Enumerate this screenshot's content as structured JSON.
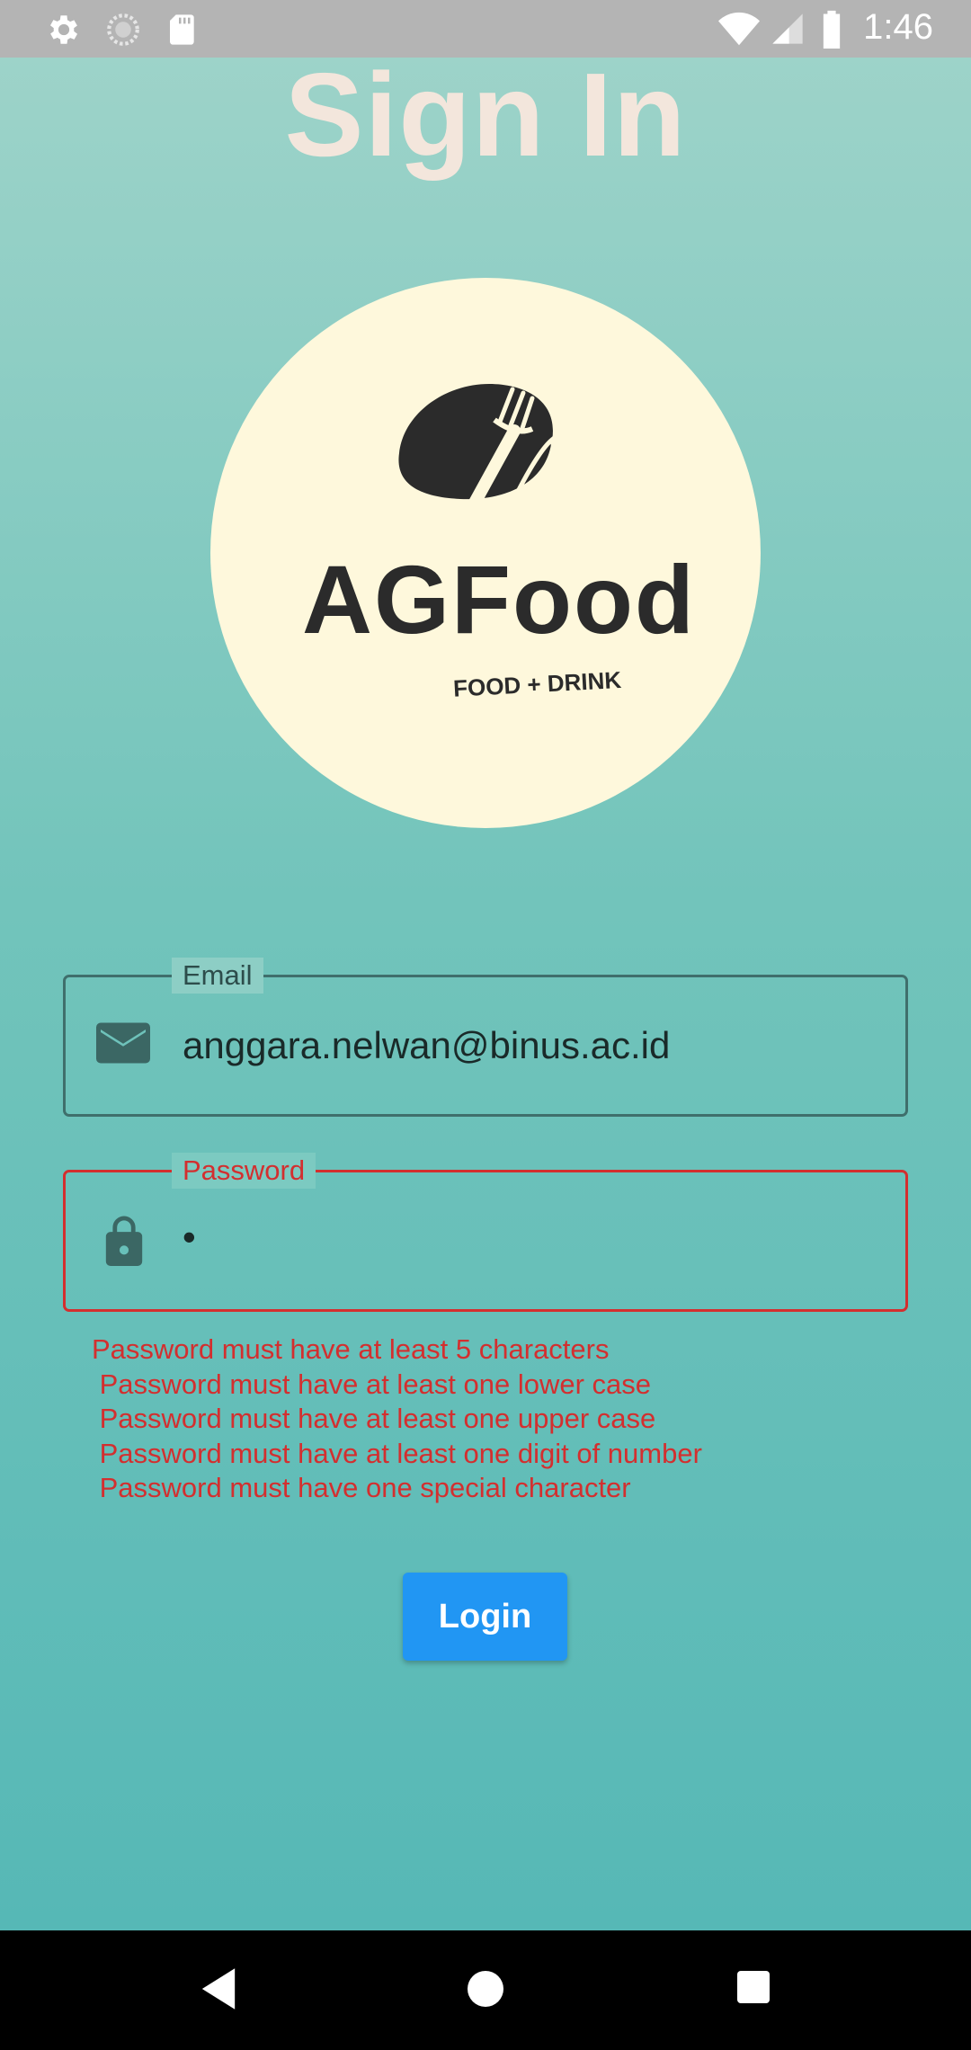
{
  "status_bar": {
    "time": "1:46",
    "icons": [
      "gear-icon",
      "sync-icon",
      "sd-card-icon",
      "wifi-icon",
      "signal-icon",
      "battery-icon"
    ]
  },
  "page": {
    "title": "Sign In"
  },
  "logo": {
    "brand": "AGFood",
    "tagline": "FOOD + DRINK"
  },
  "form": {
    "email": {
      "label": "Email",
      "value": "anggara.nelwan@binus.ac.id",
      "icon": "mail-icon"
    },
    "password": {
      "label": "Password",
      "value": "•",
      "icon": "lock-icon",
      "errors": [
        "Password must have at least 5 characters",
        " Password must have at least one lower case",
        " Password must have at least one upper case",
        " Password must have at least one digit of number",
        " Password must have one special character"
      ]
    },
    "login_label": "Login"
  },
  "colors": {
    "accent": "#2196f3",
    "error": "#d32f2f",
    "title": "#f3e6dc",
    "logo_bg": "#fef8dc",
    "bg_top": "#9dd3c9",
    "bg_bottom": "#56b8b6"
  },
  "nav_bar": {
    "buttons": [
      "back-icon",
      "home-icon",
      "recents-icon"
    ]
  }
}
